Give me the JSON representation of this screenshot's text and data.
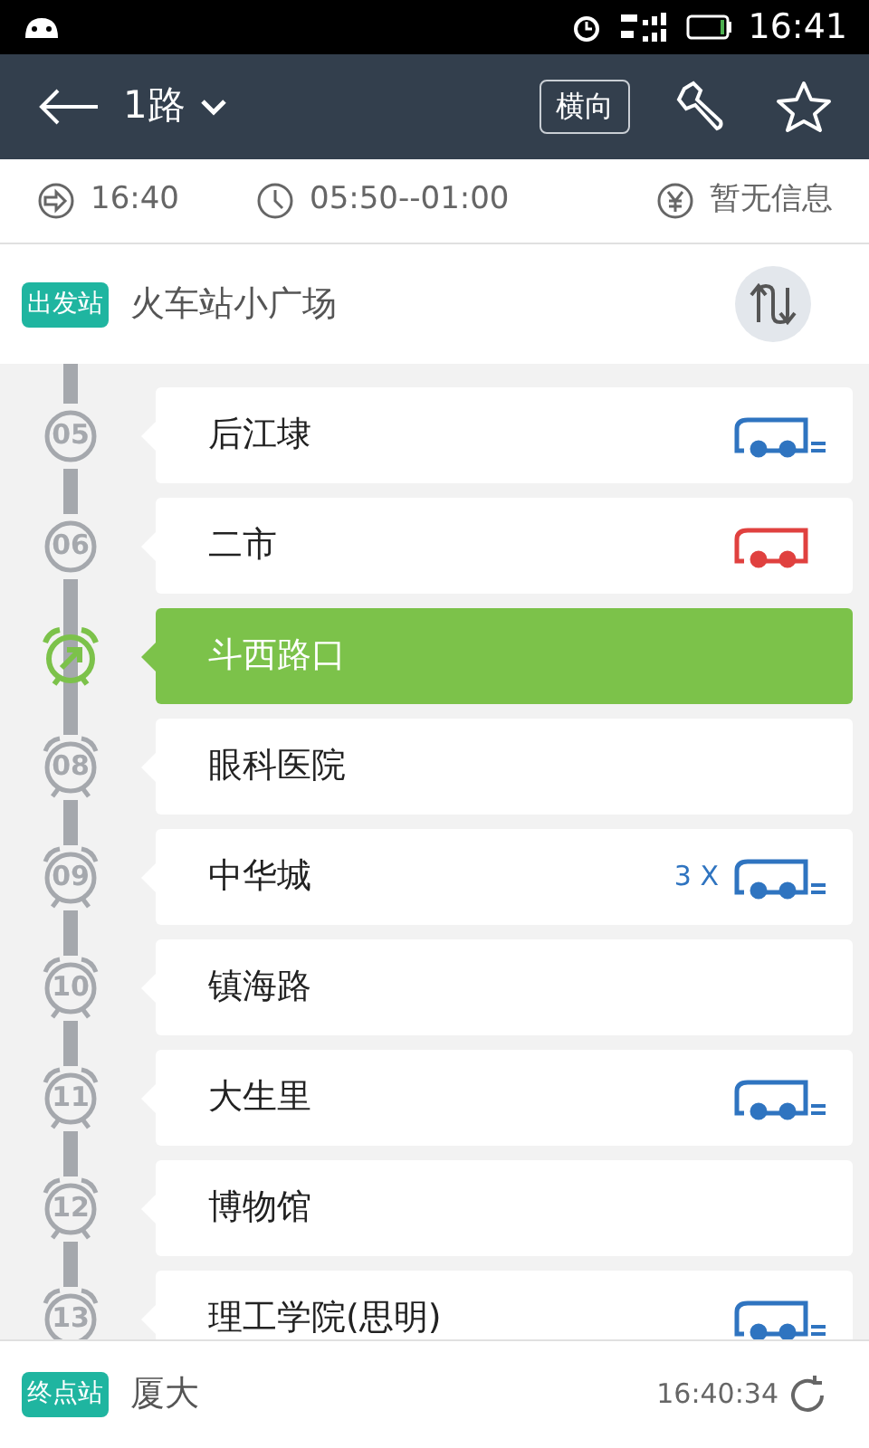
{
  "status_bar": {
    "time": "16:41"
  },
  "header": {
    "title": "1路",
    "orientation_button": "横向"
  },
  "info": {
    "departure_time": "16:40",
    "service_hours": "05:50--01:00",
    "fare": "暂无信息"
  },
  "start": {
    "badge": "出发站",
    "name": "火车站小广场"
  },
  "stops": [
    {
      "number": "05",
      "name": "后江埭",
      "kind": "plain",
      "selected": false,
      "bus": {
        "kind": "moving",
        "color": "#2f74c0"
      }
    },
    {
      "number": "06",
      "name": "二市",
      "kind": "plain",
      "selected": false,
      "bus": {
        "kind": "arrived",
        "color": "#e0413f"
      }
    },
    {
      "name": "斗西路口",
      "kind": "current",
      "selected": true
    },
    {
      "number": "08",
      "name": "眼科医院",
      "kind": "alarm",
      "selected": false
    },
    {
      "number": "09",
      "name": "中华城",
      "kind": "alarm",
      "selected": false,
      "bus": {
        "kind": "moving",
        "color": "#2f74c0",
        "count": "3 X"
      }
    },
    {
      "number": "10",
      "name": "镇海路",
      "kind": "alarm",
      "selected": false
    },
    {
      "number": "11",
      "name": "大生里",
      "kind": "alarm",
      "selected": false,
      "bus": {
        "kind": "moving",
        "color": "#2f74c0"
      }
    },
    {
      "number": "12",
      "name": "博物馆",
      "kind": "alarm",
      "selected": false
    },
    {
      "number": "13",
      "name": "理工学院(思明)",
      "kind": "alarm",
      "selected": false,
      "bus": {
        "kind": "moving",
        "color": "#2f74c0"
      }
    }
  ],
  "end": {
    "badge": "终点站",
    "name": "厦大",
    "updated": "16:40:34"
  }
}
